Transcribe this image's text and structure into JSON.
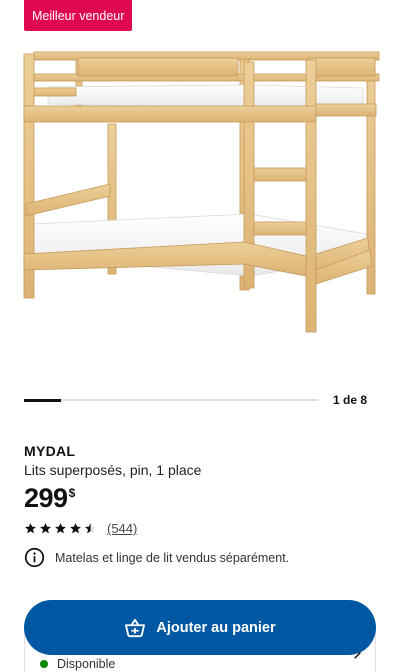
{
  "badge": {
    "label": "Meilleur vendeur"
  },
  "carousel": {
    "counter": "1 de 8",
    "current": 1,
    "total": 8
  },
  "product": {
    "name": "MYDAL",
    "description": "Lits superposés, pin, 1 place",
    "price_integer": "299",
    "price_currency": "$",
    "rating": 4.5,
    "rating_max": 5,
    "review_count": "(544)"
  },
  "notice": {
    "text": "Matelas et linge de lit vendus séparément.",
    "icon": "info-icon"
  },
  "cart": {
    "button_label": "Ajouter au panier",
    "icon": "cart-icon",
    "accent": "#0058a3"
  },
  "stock": {
    "status": "Disponible",
    "color": "#0a8a00"
  },
  "colors": {
    "badge": "#e00751",
    "accent": "#0058a3",
    "stock": "#0a8a00"
  }
}
